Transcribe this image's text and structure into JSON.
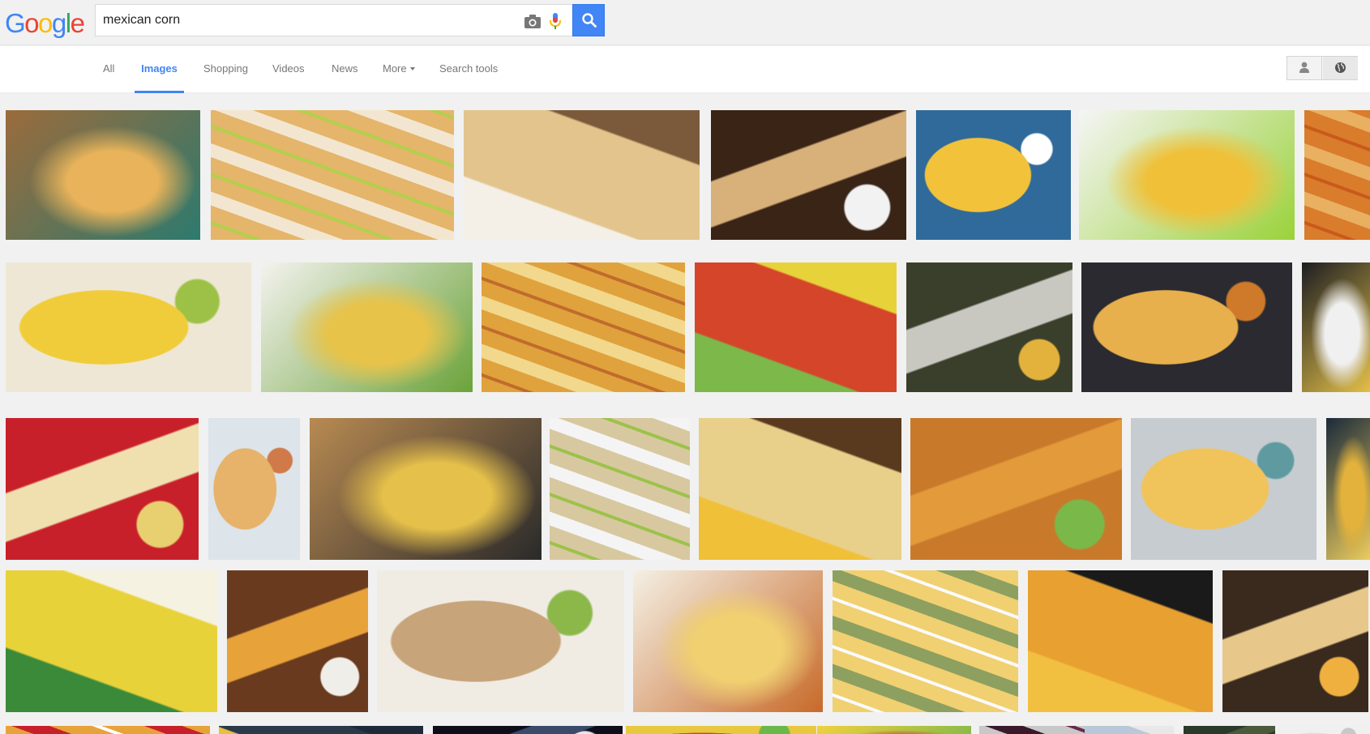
{
  "header": {
    "logo_letters": [
      {
        "ch": "G",
        "color": "#4285f4"
      },
      {
        "ch": "o",
        "color": "#ea4335"
      },
      {
        "ch": "o",
        "color": "#fbbc05"
      },
      {
        "ch": "g",
        "color": "#4285f4"
      },
      {
        "ch": "l",
        "color": "#34a853"
      },
      {
        "ch": "e",
        "color": "#ea4335"
      }
    ],
    "search_value": "mexican corn",
    "camera_icon": "camera-icon",
    "mic_icon": "microphone-icon",
    "search_icon": "magnifier-icon",
    "search_button_color": "#4285f4"
  },
  "nav": {
    "tabs": [
      {
        "label": "All",
        "active": false
      },
      {
        "label": "Images",
        "active": true
      },
      {
        "label": "Shopping",
        "active": false
      },
      {
        "label": "Videos",
        "active": false
      },
      {
        "label": "News",
        "active": false
      },
      {
        "label": "More",
        "active": false,
        "dropdown": true
      },
      {
        "label": "Search tools",
        "active": false
      }
    ],
    "right_tools": [
      "person-icon",
      "globe-icon"
    ]
  },
  "results": {
    "rows": [
      {
        "images": [
          {
            "colors": [
              "#9b6b3c",
              "#e8b35a",
              "#2d7a6e"
            ]
          },
          {
            "colors": [
              "#f3e6d0",
              "#e4b56a",
              "#b3cf4d"
            ]
          },
          {
            "colors": [
              "#7a5a3a",
              "#e2c48c",
              "#f4f0e8"
            ]
          },
          {
            "colors": [
              "#3a2416",
              "#d8b07a",
              "#f2f2f2"
            ]
          },
          {
            "colors": [
              "#2f6a9a",
              "#f2c23a",
              "#ffffff"
            ]
          },
          {
            "colors": [
              "#f5f5f5",
              "#f0c038",
              "#9bd23a"
            ]
          },
          {
            "colors": [
              "#e8b060",
              "#d97c2c",
              "#c95a1a"
            ]
          }
        ]
      },
      {
        "images": [
          {
            "colors": [
              "#efe7d5",
              "#f0cc3a",
              "#9dc146"
            ]
          },
          {
            "colors": [
              "#f4f2ee",
              "#e7c34a",
              "#6ba33a"
            ]
          },
          {
            "colors": [
              "#f1d88c",
              "#e0a23c",
              "#c06c2c"
            ]
          },
          {
            "colors": [
              "#e8d23a",
              "#d4452a",
              "#7cb84a"
            ]
          },
          {
            "colors": [
              "#3a3f2c",
              "#c8c8c0",
              "#e3b23c"
            ]
          },
          {
            "colors": [
              "#2a2a30",
              "#e7b04c",
              "#cf7a2a"
            ]
          },
          {
            "colors": [
              "#1e1e22",
              "#f0f0f0",
              "#e7c34a"
            ]
          }
        ]
      },
      {
        "images": [
          {
            "colors": [
              "#c8202a",
              "#f0e0b0",
              "#e8d070"
            ]
          },
          {
            "colors": [
              "#dde4ea",
              "#e7b26a",
              "#d07a4a"
            ]
          },
          {
            "colors": [
              "#b88a52",
              "#e5c04a",
              "#2a2a2a"
            ]
          },
          {
            "colors": [
              "#f4f4f4",
              "#d8c8a0",
              "#9cc24a"
            ]
          },
          {
            "colors": [
              "#5a3a1e",
              "#e8d08a",
              "#f0c038"
            ]
          },
          {
            "colors": [
              "#c87a2a",
              "#e39a3a",
              "#7ab84a"
            ]
          },
          {
            "colors": [
              "#c6ccd0",
              "#f0c45a",
              "#5f9aa0"
            ]
          },
          {
            "colors": [
              "#1a2a3a",
              "#e3b23c",
              "#f0d060"
            ]
          }
        ]
      },
      {
        "images": [
          {
            "colors": [
              "#f6f2e2",
              "#e8d23a",
              "#3a8a3a"
            ]
          },
          {
            "colors": [
              "#6a3a1e",
              "#e8a23a",
              "#f0eee8"
            ]
          },
          {
            "colors": [
              "#f0ece4",
              "#c8a47a",
              "#8cb84a"
            ]
          },
          {
            "colors": [
              "#f4f0e4",
              "#f0d070",
              "#c86a2a"
            ]
          },
          {
            "colors": [
              "#8ea060",
              "#f0d070",
              "#fafafa"
            ]
          },
          {
            "colors": [
              "#1a1a1a",
              "#e8a030",
              "#f2c040"
            ]
          },
          {
            "colors": [
              "#3a2a1e",
              "#e8c88a",
              "#f0b040"
            ]
          }
        ]
      },
      {
        "images": [
          {
            "colors": [
              "#c8202a",
              "#e8a23a",
              "#ffffff"
            ]
          },
          {
            "colors": [
              "#1e2a3a",
              "#2a3a4a",
              "#e8c040"
            ]
          },
          {
            "colors": [
              "#0e0e1a",
              "#3a4a6a",
              "#e8e8e8"
            ]
          },
          {
            "colors": [
              "#e8c840",
              "#c84a2a",
              "#6ab84a"
            ]
          },
          {
            "colors": [
              "#f0d040",
              "#d04a2a",
              "#7ab84a"
            ]
          },
          {
            "colors": [
              "#3a1a2a",
              "#c8c8c8",
              "#6a2a4a"
            ]
          },
          {
            "colors": [
              "#e8e8e8",
              "#b8c8d8",
              "#f0f0f0"
            ]
          },
          {
            "colors": [
              "#2a3a2a",
              "#4a5a3a",
              "#e8e8e8"
            ]
          },
          {
            "colors": [
              "#f0f0f0",
              "#e0e0e0",
              "#c8c8c8"
            ]
          }
        ]
      }
    ]
  }
}
